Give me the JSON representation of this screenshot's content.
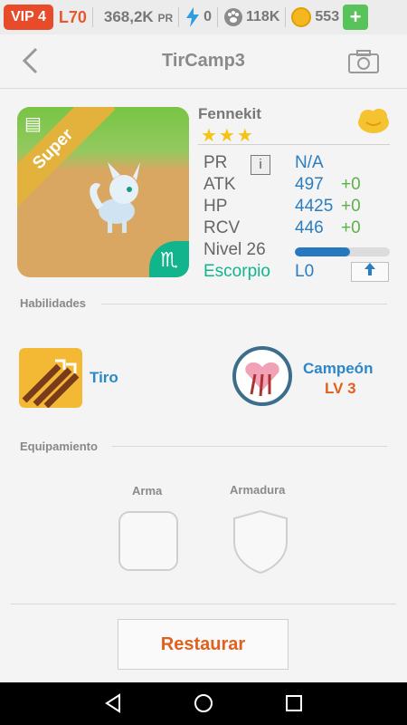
{
  "status": {
    "vip": "VIP 4",
    "level": "L70",
    "power_value": "368,2K",
    "power_unit": "PR",
    "energy": "0",
    "food": "118K",
    "coins": "553",
    "plus": "+"
  },
  "header": {
    "title": "TirCamp3"
  },
  "pet": {
    "rarity": "Super",
    "name": "Fennekit",
    "stars": "★★★",
    "stats": [
      {
        "label": "PR",
        "value": "N/A",
        "bonus": ""
      },
      {
        "label": "ATK",
        "value": "497",
        "bonus": "+0"
      },
      {
        "label": "HP",
        "value": "4425",
        "bonus": "+0"
      },
      {
        "label": "RCV",
        "value": "446",
        "bonus": "+0"
      }
    ],
    "level_label": "Nivel 26",
    "level_progress": 0.58,
    "zodiac": "Escorpio",
    "zodiac_level": "L0",
    "zodiac_symbol": "♏"
  },
  "skills": {
    "heading": "Habilidades",
    "items": [
      {
        "name": "Tiro",
        "level": ""
      },
      {
        "name": "Campeón",
        "level": "LV 3"
      }
    ]
  },
  "equipment": {
    "heading": "Equipamiento",
    "weapon": "Arma",
    "armor": "Armadura"
  },
  "actions": {
    "restore": "Restaurar"
  },
  "colors": {
    "accent": "#e2601d",
    "blue": "#2b7dc2",
    "green": "#12b48e"
  }
}
